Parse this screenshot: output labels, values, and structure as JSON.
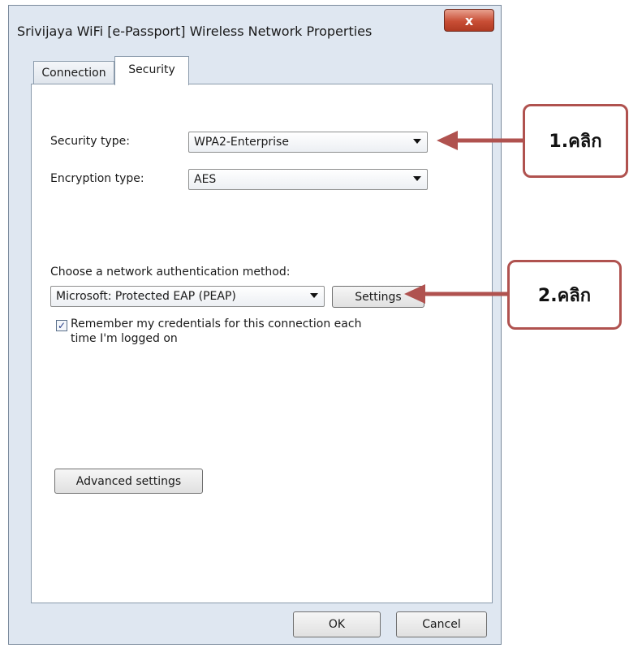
{
  "window": {
    "title": "Srivijaya WiFi [e-Passport] Wireless Network Properties",
    "close_glyph": "x"
  },
  "tabs": [
    {
      "label": "Connection",
      "selected": false
    },
    {
      "label": "Security",
      "selected": true
    }
  ],
  "security": {
    "security_type_label": "Security type:",
    "security_type_value": "WPA2-Enterprise",
    "encryption_type_label": "Encryption type:",
    "encryption_type_value": "AES",
    "auth_method_label": "Choose a network authentication method:",
    "auth_method_value": "Microsoft: Protected EAP (PEAP)",
    "settings_button": "Settings",
    "remember_checked": true,
    "remember_label_line1": "Remember my credentials for this connection each",
    "remember_label_line2": "time I'm logged on",
    "advanced_button": "Advanced settings"
  },
  "footer": {
    "ok_button": "OK",
    "cancel_button": "Cancel"
  },
  "annotations": {
    "step1": "1.คลิก",
    "step2": "2.คลิก",
    "color": "#b0524f"
  }
}
